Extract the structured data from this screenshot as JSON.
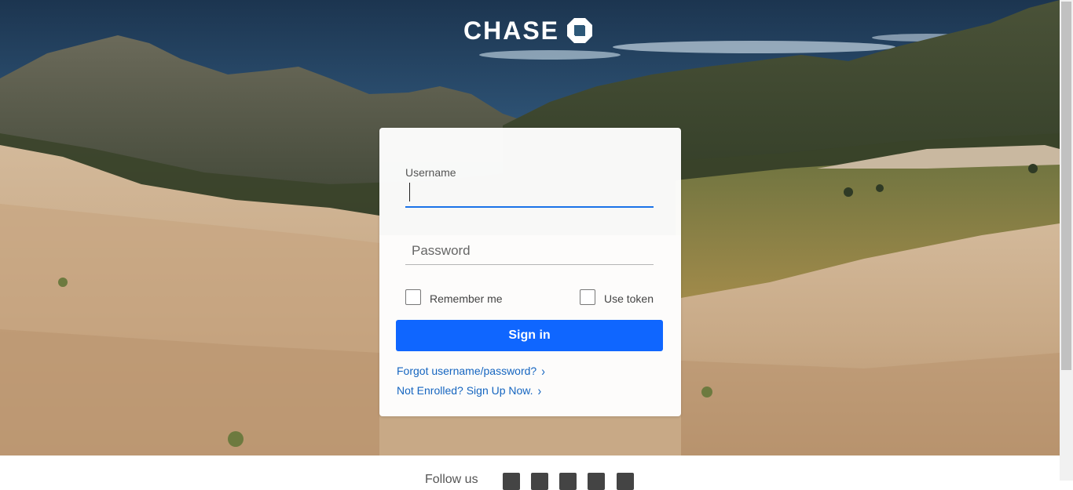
{
  "brand": {
    "name": "CHASE",
    "logo_icon": "chase-octagon-icon"
  },
  "login": {
    "username_label": "Username",
    "username_value": "",
    "password_placeholder": "Password",
    "remember_label": "Remember me",
    "token_label": "Use token",
    "signin_label": "Sign in",
    "forgot_link": "Forgot username/password?",
    "enroll_link": "Not Enrolled? Sign Up Now.",
    "chevron": "›"
  },
  "footer": {
    "follow_text": "Follow us",
    "social_icons": [
      "facebook-icon",
      "instagram-icon",
      "twitter-icon",
      "youtube-icon",
      "linkedin-icon"
    ]
  },
  "colors": {
    "primary_button": "#0f66ff",
    "link": "#1565c0",
    "focus_underline": "#1a73e8"
  }
}
